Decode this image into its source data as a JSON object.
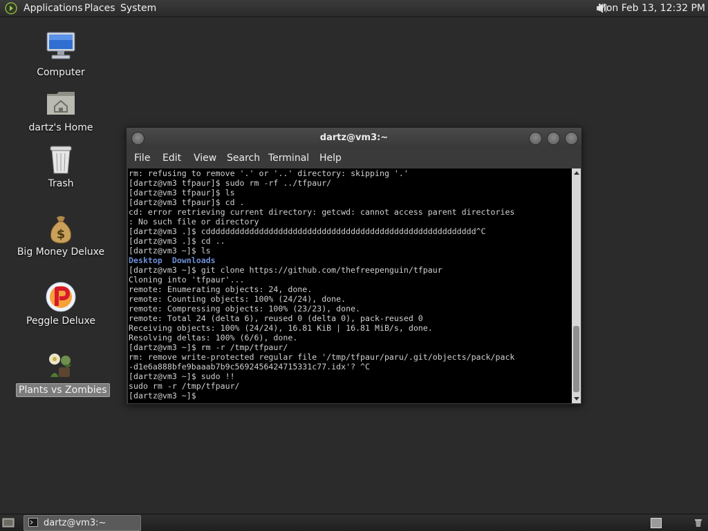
{
  "top_panel": {
    "menus": [
      "Applications",
      "Places",
      "System"
    ],
    "clock": "Mon Feb 13, 12:32 PM"
  },
  "desktop_icons": [
    {
      "label": "Computer",
      "icon": "computer-icon"
    },
    {
      "label": "dartz's Home",
      "icon": "home-folder-icon"
    },
    {
      "label": "Trash",
      "icon": "trash-icon"
    },
    {
      "label": "Big Money Deluxe",
      "icon": "money-bag-icon"
    },
    {
      "label": "Peggle Deluxe",
      "icon": "peggle-icon"
    },
    {
      "label": "Plants vs Zombies",
      "icon": "plants-vs-zombies-icon",
      "selected": true
    }
  ],
  "terminal": {
    "title": "dartz@vm3:~",
    "menus": [
      "File",
      "Edit",
      "View",
      "Search",
      "Terminal",
      "Help"
    ],
    "lines": [
      "rm: refusing to remove '.' or '..' directory: skipping '.'",
      "[dartz@vm3 tfpaur]$ sudo rm -rf ../tfpaur/",
      "[dartz@vm3 tfpaur]$ ls",
      "[dartz@vm3 tfpaur]$ cd .",
      "cd: error retrieving current directory: getcwd: cannot access parent directories",
      ": No such file or directory",
      "[dartz@vm3 .]$ cdddddddddddddddddddddddddddddddddddddddddddddddddddddddd^C",
      "[dartz@vm3 .]$ cd ..",
      "[dartz@vm3 ~]$ ls",
      "",
      "[dartz@vm3 ~]$ git clone https://github.com/thefreepenguin/tfpaur",
      "Cloning into 'tfpaur'...",
      "remote: Enumerating objects: 24, done.",
      "remote: Counting objects: 100% (24/24), done.",
      "remote: Compressing objects: 100% (23/23), done.",
      "remote: Total 24 (delta 6), reused 0 (delta 0), pack-reused 0",
      "Receiving objects: 100% (24/24), 16.81 KiB | 16.81 MiB/s, done.",
      "Resolving deltas: 100% (6/6), done.",
      "[dartz@vm3 ~]$ rm -r /tmp/tfpaur/",
      "rm: remove write-protected regular file '/tmp/tfpaur/paru/.git/objects/pack/pack",
      "-d1e6a888bfe9baaab7b9c5692456424715331c77.idx'? ^C",
      "[dartz@vm3 ~]$ sudo !!",
      "sudo rm -r /tmp/tfpaur/",
      "[dartz@vm3 ~]$ "
    ],
    "dir_listing": [
      "Desktop",
      "Downloads"
    ],
    "dir_listing_line": 9
  },
  "bottom_panel": {
    "task_label": "dartz@vm3:~"
  }
}
